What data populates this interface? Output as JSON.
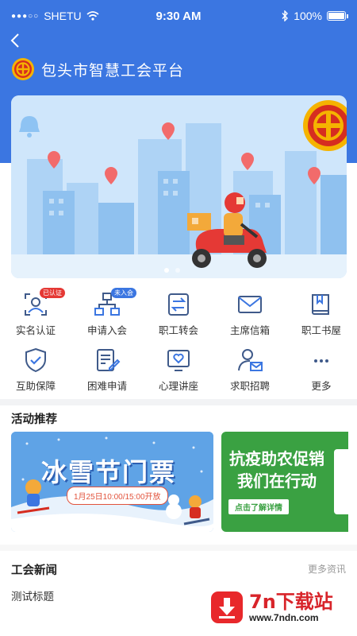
{
  "status_bar": {
    "carrier": "SHETU",
    "time": "9:30 AM",
    "battery": "100%"
  },
  "header": {
    "title": "包头市智慧工会平台"
  },
  "banner": {
    "slides": 2,
    "active_slide": 1
  },
  "services": [
    {
      "label": "实名认证",
      "badge": "已认证",
      "icon": "id-verify-icon"
    },
    {
      "label": "申请入会",
      "badge": "未入会",
      "icon": "org-chart-icon"
    },
    {
      "label": "职工转会",
      "badge": "",
      "icon": "transfer-icon"
    },
    {
      "label": "主席信箱",
      "badge": "",
      "icon": "mail-icon"
    },
    {
      "label": "职工书屋",
      "badge": "",
      "icon": "book-icon"
    },
    {
      "label": "互助保障",
      "badge": "",
      "icon": "shield-check-icon"
    },
    {
      "label": "困难申请",
      "badge": "",
      "icon": "document-edit-icon"
    },
    {
      "label": "心理讲座",
      "badge": "",
      "icon": "heart-screen-icon"
    },
    {
      "label": "求职招聘",
      "badge": "",
      "icon": "user-mail-icon"
    },
    {
      "label": "更多",
      "badge": "",
      "icon": "more-dots-icon"
    }
  ],
  "activities": {
    "title": "活动推荐",
    "cards": [
      {
        "title": "冰雪节门票",
        "subtitle": "1月25日10:00/15:00开放"
      },
      {
        "title_line1": "抗疫助农促销",
        "title_line2": "我们在行动",
        "button": "点击了解详情"
      }
    ]
  },
  "news": {
    "title": "工会新闻",
    "more": "更多资讯",
    "items": [
      "测试标题"
    ]
  },
  "watermark": {
    "brand": "7n下载站",
    "url": "www.7ndn.com"
  },
  "colors": {
    "primary": "#3b76e1",
    "badge_red": "#e53935",
    "icon": "#3f5a8a"
  }
}
